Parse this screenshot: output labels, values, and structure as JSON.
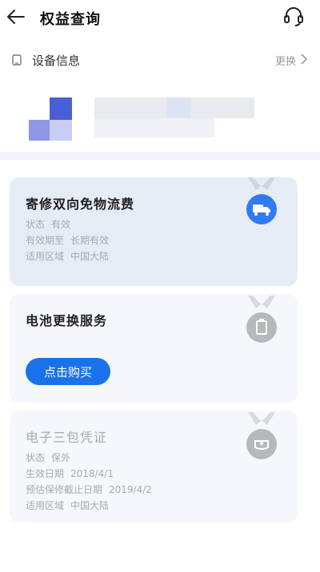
{
  "header": {
    "title": "权益查询",
    "back_icon": "arrow-left-icon",
    "support_icon": "headset-icon"
  },
  "device": {
    "section_title": "设备信息",
    "change_label": "更换"
  },
  "cards": [
    {
      "title": "寄修双向免物流费",
      "status_label": "状态",
      "status_value": "有效",
      "period_label": "有效期至",
      "period_value": "长期有效",
      "region_label": "适用区域",
      "region_value": "中国大陆",
      "badge_icon": "truck-medal-icon",
      "badge_color": "#2f7bf0"
    },
    {
      "title": "电池更换服务",
      "buy_label": "点击购买",
      "badge_icon": "battery-medal-icon",
      "badge_color": "#b7b8bb"
    },
    {
      "title": "电子三包凭证",
      "status_label": "状态",
      "status_value": "保外",
      "start_label": "生效日期",
      "start_value": "2018/4/1",
      "end_label": "预估保修截止日期",
      "end_value": "2019/4/2",
      "region_label": "适用区域",
      "region_value": "中国大陆",
      "badge_icon": "certificate-medal-icon",
      "badge_color": "#b7b8bb"
    }
  ],
  "colors": {
    "accent": "#1a72ea",
    "active_card_bg": "#e6ecf6",
    "inactive_card_bg": "#f6f7fa"
  }
}
